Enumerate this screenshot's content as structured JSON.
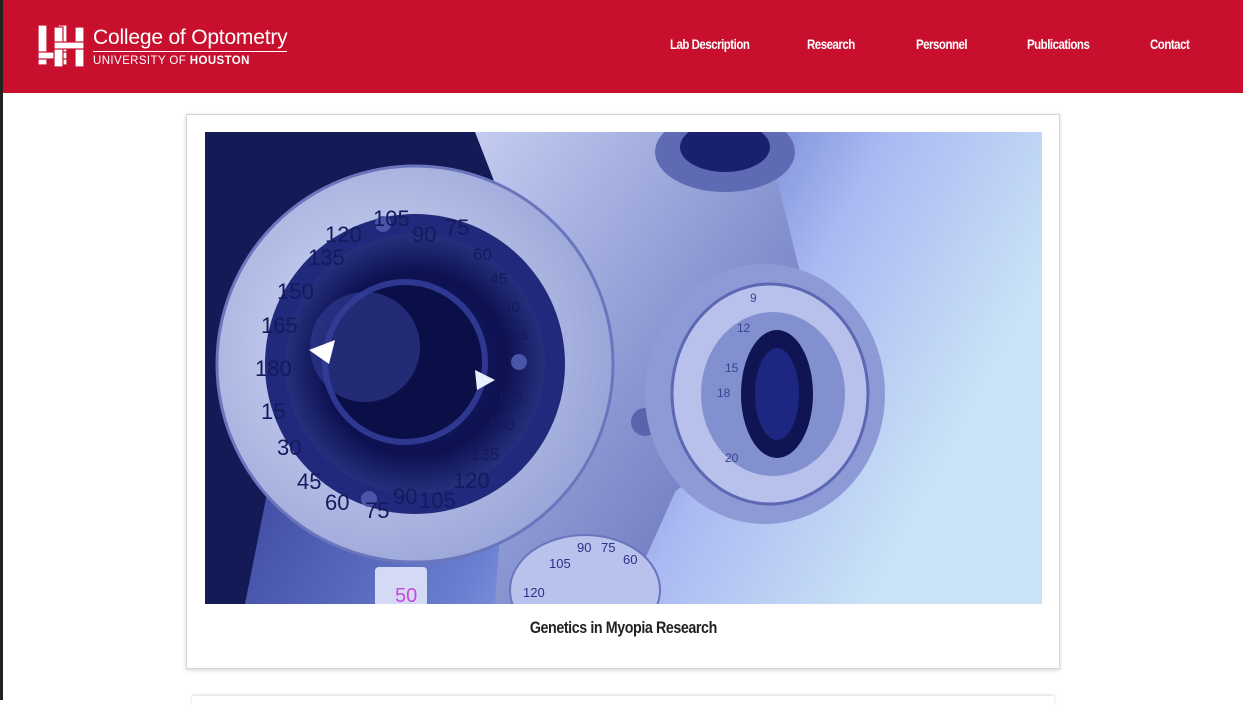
{
  "header": {
    "college_name": "College of Optometry",
    "university_prefix": "UNIVERSITY OF ",
    "university_bold": "HOUSTON",
    "brand_color": "#c8102e"
  },
  "nav": {
    "items": [
      {
        "label": "Lab Description"
      },
      {
        "label": "Research"
      },
      {
        "label": "Personnel"
      },
      {
        "label": "Publications"
      },
      {
        "label": "Contact"
      }
    ]
  },
  "hero": {
    "caption": "Genetics in Myopia Research",
    "dial_numbers": {
      "upper": [
        "120",
        "105",
        "90",
        "75",
        "60",
        "45",
        "30",
        "15"
      ],
      "left": [
        "135",
        "150",
        "165",
        "180",
        "15",
        "30",
        "45"
      ],
      "lower": [
        "60",
        "75",
        "90",
        "105",
        "120",
        "135",
        "150",
        "165"
      ],
      "small_dial": [
        "105",
        "90",
        "75",
        "60",
        "120"
      ],
      "side_dial": [
        "9",
        "12",
        "15",
        "18",
        "20"
      ],
      "counter": "50"
    }
  }
}
